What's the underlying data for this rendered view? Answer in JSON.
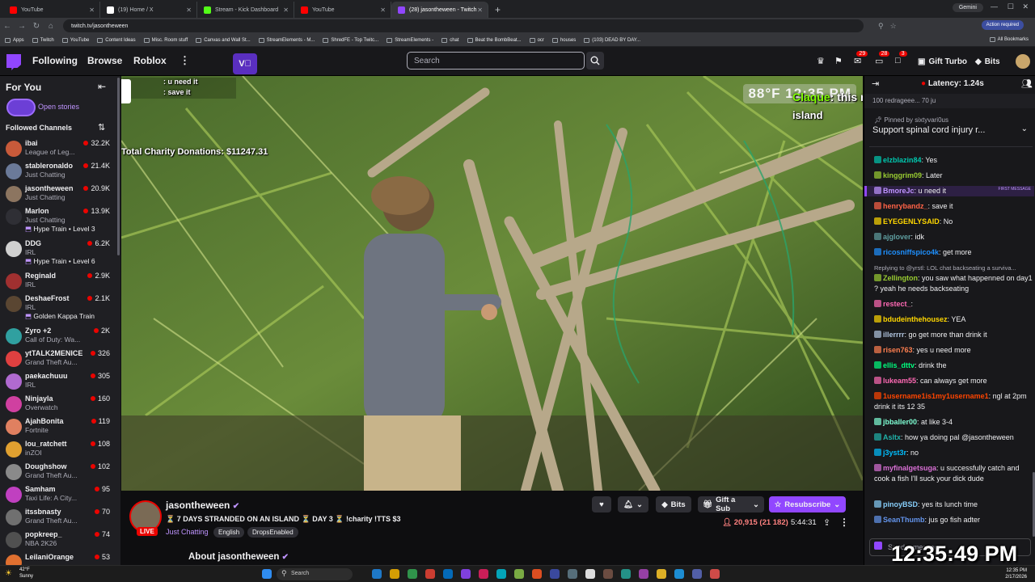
{
  "browser": {
    "tabs": [
      {
        "title": "YouTube",
        "color": "#ff0000"
      },
      {
        "title": "(19) Home / X",
        "color": "#ffffff"
      },
      {
        "title": "Stream - Kick Dashboard",
        "color": "#53fc18"
      },
      {
        "title": "YouTube",
        "color": "#ff0000"
      },
      {
        "title": "(28) jasontheween - Twitch",
        "color": "#9146ff"
      }
    ],
    "profile_label": "Gemini",
    "url": "twitch.tv/jasontheween",
    "action_required": "Action required",
    "bookmarks": [
      "Apps",
      "Twitch",
      "YouTube",
      "Content Ideas",
      "Misc. Room stuff",
      "Canvas and Wall St...",
      "StreamElements - M...",
      "ShredFE - Top Twitc...",
      "StreamElements -",
      "chat",
      "Beat the BombBeat...",
      "ocr",
      "houses",
      "(103) DEAD BY DAY..."
    ],
    "all_bookmarks": "All Bookmarks"
  },
  "twitch_nav": {
    "following": "Following",
    "browse": "Browse",
    "roblox": "Roblox",
    "search_placeholder": "Search",
    "badges": [
      "29",
      "28",
      "3"
    ],
    "gift_turbo": "Gift Turbo",
    "bits": "Bits"
  },
  "sidebar": {
    "for_you": "For You",
    "open_stories": "Open stories",
    "followed_channels": "Followed Channels",
    "channels": [
      {
        "name": "ibai",
        "game": "League of Leg...",
        "viewers": "32.2K",
        "color": "#c85a3a"
      },
      {
        "name": "stableronaldo",
        "game": "Just Chatting",
        "viewers": "21.4K",
        "color": "#6b7a99"
      },
      {
        "name": "jasontheween",
        "game": "Just Chatting",
        "viewers": "20.9K",
        "color": "#8c7560"
      },
      {
        "name": "Marlon",
        "game": "Just Chatting",
        "viewers": "13.9K",
        "color": "#2f2f35",
        "extra": "Hype Train • Level 3"
      },
      {
        "name": "DDG",
        "game": "IRL",
        "viewers": "6.2K",
        "color": "#d0d0d0",
        "extra": "Hype Train • Level 6"
      },
      {
        "name": "Reginald",
        "game": "IRL",
        "viewers": "2.9K",
        "color": "#a03030"
      },
      {
        "name": "DeshaeFrost",
        "game": "IRL",
        "viewers": "2.1K",
        "color": "#5a4632",
        "extra": "Golden Kappa Train"
      },
      {
        "name": "Zyro +2",
        "game": "Call of Duty: Wa...",
        "viewers": "2K",
        "color": "#30a0a0"
      },
      {
        "name": "ytTALK2MENICE",
        "game": "Grand Theft Au...",
        "viewers": "326",
        "color": "#e04040"
      },
      {
        "name": "paekachuuu",
        "game": "IRL",
        "viewers": "305",
        "color": "#b06ad0"
      },
      {
        "name": "Ninjayla",
        "game": "Overwatch",
        "viewers": "160",
        "color": "#d040a0"
      },
      {
        "name": "AjahBonita",
        "game": "Fortnite",
        "viewers": "119",
        "color": "#e08060"
      },
      {
        "name": "lou_ratchett",
        "game": "inZOI",
        "viewers": "108",
        "color": "#e0a030"
      },
      {
        "name": "Doughshow",
        "game": "Grand Theft Au...",
        "viewers": "102",
        "color": "#8a8a8a"
      },
      {
        "name": "Samham",
        "game": "Taxi Life: A City...",
        "viewers": "95",
        "color": "#c040c0"
      },
      {
        "name": "itssbnasty",
        "game": "Grand Theft Au...",
        "viewers": "70",
        "color": "#707070"
      },
      {
        "name": "popkreep_",
        "game": "NBA 2K26",
        "viewers": "74",
        "color": "#505050"
      },
      {
        "name": "LeilaniOrange",
        "game": "",
        "viewers": "53",
        "color": "#e07030"
      }
    ]
  },
  "video": {
    "overlay_chat": [
      {
        "user": "",
        "text": ": u need it"
      },
      {
        "user": "",
        "text": ": save it"
      }
    ],
    "charity": "Total Charity Donations: $11247.31",
    "clock": "88°F  12:35 PM",
    "tts_user": "Claque",
    "tts_text": ": this nigga went to the closet",
    "island": "island"
  },
  "stream": {
    "name": "jasontheween",
    "title": "⏳ 7 DAYS STRANDED ON AN ISLAND ⏳ DAY 3 ⏳ !charity !TTS $3",
    "game": "Just Chatting",
    "tags": [
      "English",
      "DropsEnabled"
    ],
    "live": "LIVE",
    "viewers": "20,915 (21 182)",
    "uptime": "5:44:31",
    "bits": "Bits",
    "gift_sub": "Gift a Sub",
    "resubscribe": "Resubscribe",
    "about": "About jasontheween"
  },
  "chat": {
    "latency": "Latency: 1.24s",
    "top_row": "100   redrageee...  70  ju",
    "pinned_by": "Pinned by  sixtyvari0us",
    "pinned_text": "Support spinal cord injury r...",
    "messages": [
      {
        "user": "elzblazin84",
        "text": ": Yes",
        "color": "#00c8af"
      },
      {
        "user": "kinggrim09",
        "text": ": Later",
        "color": "#9acd32"
      },
      {
        "user": "BmoreJc",
        "text": ": u need it",
        "color": "#bf94ff",
        "first": "FIRST MESSAGE"
      },
      {
        "user": "henrybandz_",
        "text": ": save it",
        "color": "#ff6347"
      },
      {
        "user": "EYEGENLYSAID",
        "text": ": No",
        "color": "#ffd700"
      },
      {
        "user": "ajglover",
        "text": ": idk",
        "color": "#5f9ea0"
      },
      {
        "user": "ricosniffspico4k",
        "text": ": get more",
        "color": "#1e90ff"
      },
      {
        "user": "Zellington",
        "text": ": you saw what happenned on day1 ? yeah he needs backseating",
        "color": "#9acd32",
        "reply": "Replying to @yrstl: LOL chat backseating a surviva..."
      },
      {
        "user": "restect_",
        "text": ": ",
        "color": "#ff69b4"
      },
      {
        "user": "bdudeinthehousez",
        "text": ": YEA",
        "color": "#ffd700"
      },
      {
        "user": "illerrrr",
        "text": ": go get more than drink it",
        "color": "#b0c4de"
      },
      {
        "user": "risen763",
        "text": ": yes u need more",
        "color": "#ff7f50"
      },
      {
        "user": "ellis_dttv",
        "text": ": drink the",
        "color": "#00ff7f"
      },
      {
        "user": "lukeam55",
        "text": ": can always get more",
        "color": "#ff69b4"
      },
      {
        "user": "1username1is1my1username1",
        "text": ": ngl at 2pm drink it its 12 35",
        "color": "#ff4500"
      },
      {
        "user": "jbballer00",
        "text": ": at like 3-4",
        "color": "#7fffd4"
      },
      {
        "user": "Asltx",
        "text": ": how ya doing pal @jasontheween",
        "color": "#20b2aa"
      },
      {
        "user": "j3yst3r",
        "text": ": no",
        "color": "#00bfff"
      },
      {
        "user": "myfinalgetsuga",
        "text": ": u successfully catch and cook a fish I'll suck your dick dude",
        "color": "#da70d6"
      },
      {
        "user": "pinoyBSD",
        "text": ": yes its lunch time",
        "color": "#87cefa"
      },
      {
        "user": "SeanThumb",
        "text": ": jus go fish adter",
        "color": "#6495ed"
      }
    ],
    "send_placeholder": "Send a message",
    "big_clock": "12:35:49 PM"
  },
  "taskbar": {
    "temp": "42°F",
    "weather": "Sunny",
    "search": "Search",
    "time": "12:35 PM",
    "date": "2/17/2026"
  }
}
